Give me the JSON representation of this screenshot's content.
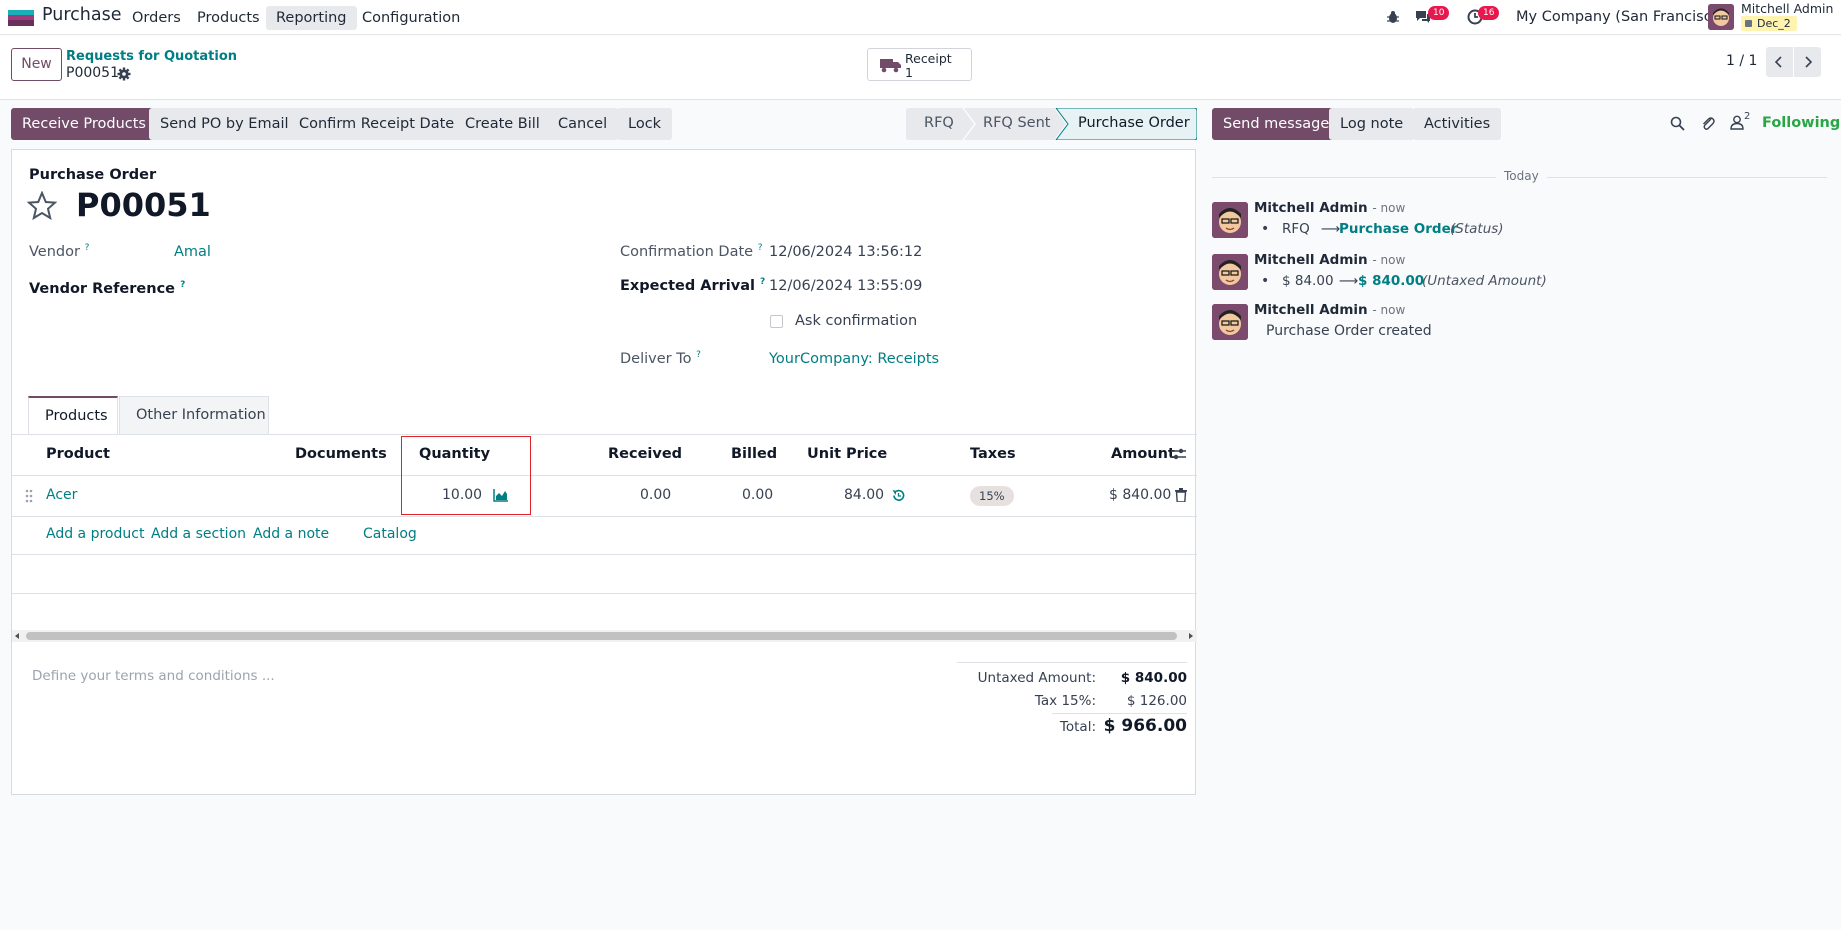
{
  "navbar": {
    "app_name": "Purchase",
    "menu": [
      "Orders",
      "Products",
      "Reporting",
      "Configuration"
    ],
    "messages_count": "10",
    "activities_count": "16",
    "company": "My Company (San Francisco)",
    "user_name": "Mitchell Admin",
    "user_db": "Dec_2"
  },
  "control": {
    "new_label": "New",
    "breadcrumb_parent": "Requests for Quotation",
    "breadcrumb_current": "P00051",
    "receipt_label": "Receipt",
    "receipt_count": "1",
    "pager": "1 / 1"
  },
  "actions": {
    "receive_products": "Receive Products",
    "send_po_email": "Send PO by Email",
    "confirm_receipt_date": "Confirm Receipt Date",
    "create_bill": "Create Bill",
    "cancel": "Cancel",
    "lock": "Lock"
  },
  "statusbar": [
    "RFQ",
    "RFQ Sent",
    "Purchase Order"
  ],
  "chatter_actions": {
    "send_message": "Send message",
    "log_note": "Log note",
    "activities": "Activities",
    "followers_count": "2",
    "following": "Following"
  },
  "form": {
    "doc_type": "Purchase Order",
    "name": "P00051",
    "vendor_label": "Vendor",
    "vendor_value": "Amal",
    "vendor_ref_label": "Vendor Reference",
    "confirmation_date_label": "Confirmation Date",
    "confirmation_date_value": "12/06/2024 13:56:12",
    "expected_arrival_label": "Expected Arrival",
    "expected_arrival_value": "12/06/2024 13:55:09",
    "ask_confirmation": "Ask confirmation",
    "deliver_to_label": "Deliver To",
    "deliver_to_value": "YourCompany: Receipts",
    "question_mark": "?"
  },
  "tabs": [
    "Products",
    "Other Information"
  ],
  "table": {
    "headers": {
      "product": "Product",
      "documents": "Documents",
      "quantity": "Quantity",
      "received": "Received",
      "billed": "Billed",
      "unit_price": "Unit Price",
      "taxes": "Taxes",
      "amount": "Amount"
    },
    "rows": [
      {
        "product": "Acer",
        "quantity": "10.00",
        "received": "0.00",
        "billed": "0.00",
        "unit_price": "84.00",
        "taxes": "15%",
        "amount": "$ 840.00"
      }
    ],
    "add_product": "Add a product",
    "add_section": "Add a section",
    "add_note": "Add a note",
    "catalog": "Catalog"
  },
  "terms_placeholder": "Define your terms and conditions ...",
  "totals": {
    "untaxed_label": "Untaxed Amount:",
    "untaxed_value": "$ 840.00",
    "tax_label": "Tax 15%:",
    "tax_value": "$ 126.00",
    "total_label": "Total:",
    "total_value": "$ 966.00"
  },
  "chatter": {
    "date_separator": "Today",
    "messages": [
      {
        "author": "Mitchell Admin",
        "time": "- now",
        "old": "RFQ",
        "new": "Purchase Order",
        "field": "(Status)"
      },
      {
        "author": "Mitchell Admin",
        "time": "- now",
        "old": "$ 84.00",
        "new": "$ 840.00",
        "field": "(Untaxed Amount)"
      },
      {
        "author": "Mitchell Admin",
        "time": "- now",
        "body": "Purchase Order created"
      }
    ]
  },
  "colors": {
    "brand": "#714b67",
    "link": "#017e84",
    "badge": "#e8184f",
    "highlight": "#e0242c"
  }
}
